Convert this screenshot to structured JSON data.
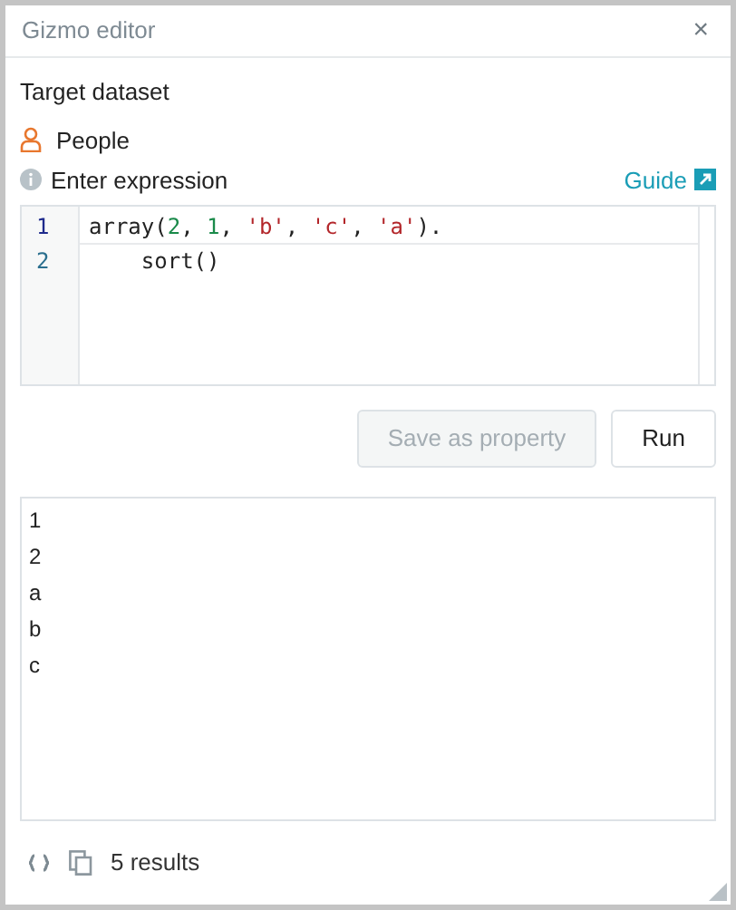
{
  "window": {
    "title": "Gizmo editor",
    "close": "×"
  },
  "target_label": "Target dataset",
  "dataset": {
    "name": "People"
  },
  "expression": {
    "label": "Enter expression",
    "guide_link": "Guide"
  },
  "editor": {
    "lines": [
      {
        "number": "1",
        "tokens": [
          {
            "kind": "plain",
            "text": "array("
          },
          {
            "kind": "number",
            "text": "2"
          },
          {
            "kind": "plain",
            "text": ", "
          },
          {
            "kind": "number",
            "text": "1"
          },
          {
            "kind": "plain",
            "text": ", "
          },
          {
            "kind": "string",
            "text": "'b'"
          },
          {
            "kind": "plain",
            "text": ", "
          },
          {
            "kind": "string",
            "text": "'c'"
          },
          {
            "kind": "plain",
            "text": ", "
          },
          {
            "kind": "string",
            "text": "'a'"
          },
          {
            "kind": "plain",
            "text": ")."
          }
        ]
      },
      {
        "number": "2",
        "tokens": [
          {
            "kind": "plain",
            "text": "    sort()"
          }
        ]
      }
    ]
  },
  "buttons": [
    {
      "label": "Save as property",
      "disabled": true
    },
    {
      "label": "Run",
      "disabled": false
    }
  ],
  "results": [
    "1",
    "2",
    "a",
    "b",
    "c"
  ],
  "status": "5 results"
}
